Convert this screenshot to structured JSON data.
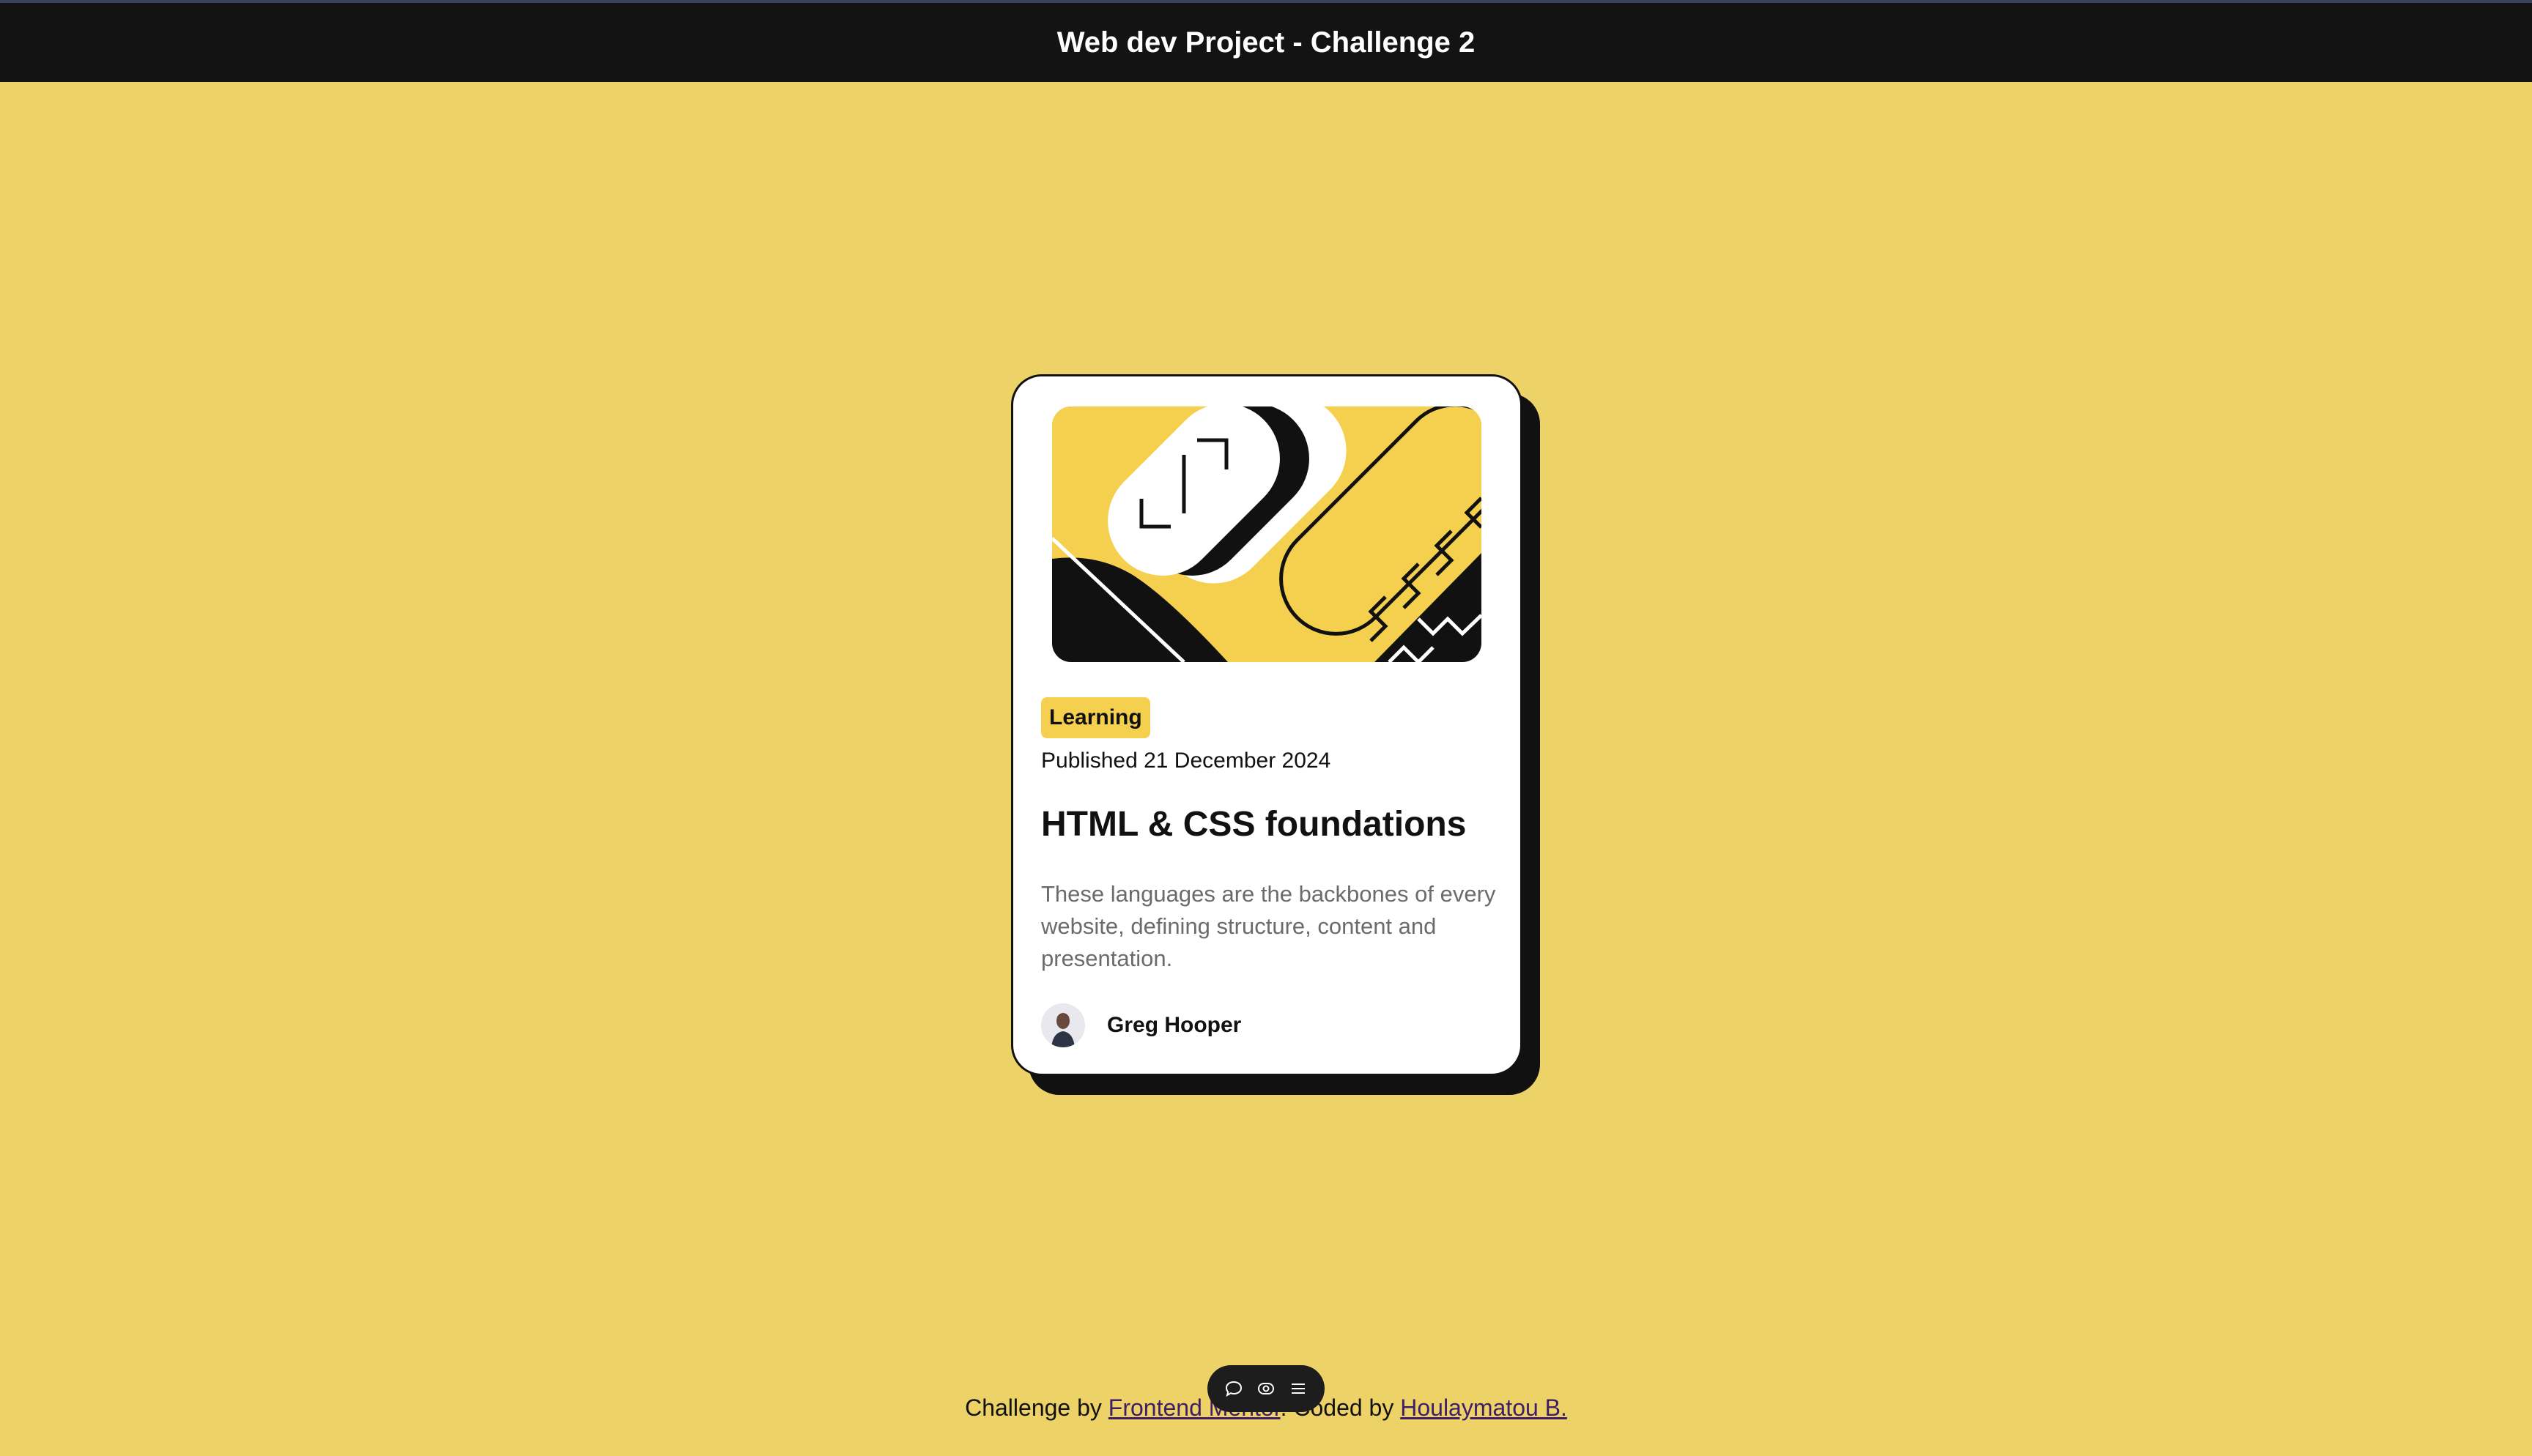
{
  "header": {
    "title": "Web dev Project - Challenge 2"
  },
  "card": {
    "tag": "Learning",
    "published": "Published 21 December 2024",
    "title": "HTML & CSS foundations",
    "description": "These languages are the backbones of every website, defining structure, content and presentation.",
    "author": {
      "name": "Greg Hooper"
    }
  },
  "toolbar": {
    "icons": [
      "comment-icon",
      "eye-icon",
      "menu-icon"
    ]
  },
  "footer": {
    "prefix": "Challenge by ",
    "link1": "Frontend Mentor",
    "middle": ". Coded by ",
    "link2": "Houlaymatou B."
  },
  "colors": {
    "page_background": "#ECD267",
    "accent_yellow": "#F4D04E",
    "dark": "#111111",
    "header_background": "#131313",
    "link": "#3e1e68"
  }
}
